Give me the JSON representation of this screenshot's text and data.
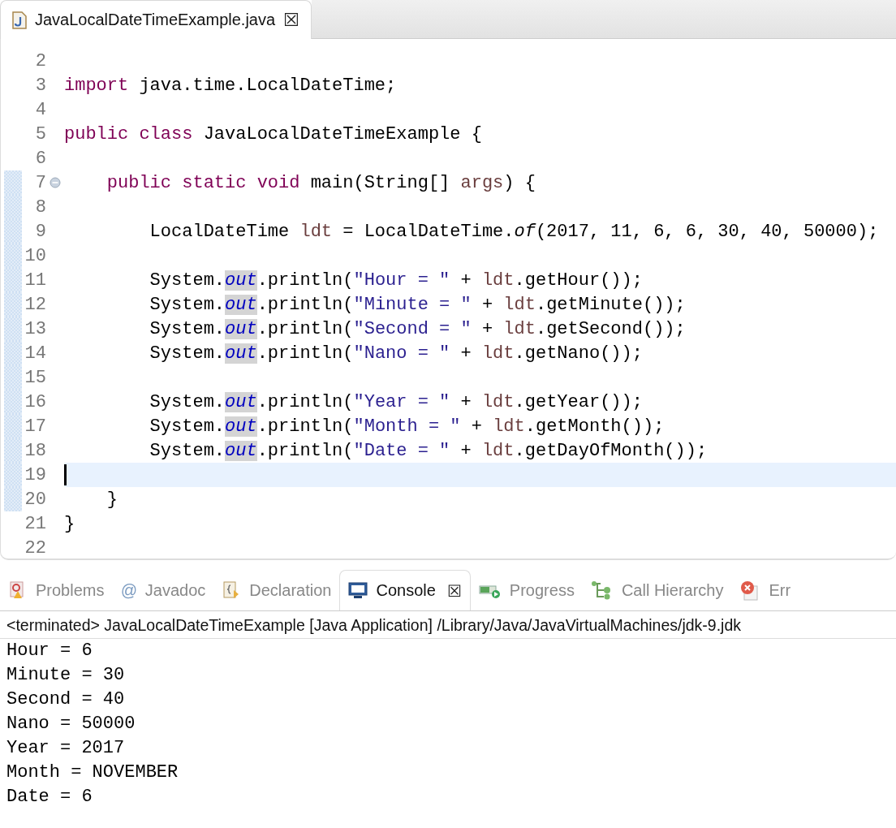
{
  "editor_tab": {
    "title": "JavaLocalDateTimeExample.java",
    "close": "☒"
  },
  "code_lines": [
    {
      "number": "2",
      "current": false,
      "changed": false,
      "fold": false
    },
    {
      "number": "3",
      "current": false,
      "changed": false,
      "fold": false,
      "tokens": [
        {
          "kind": "keyword",
          "text": "import"
        },
        {
          "kind": "plain",
          "text": " java.time.LocalDateTime;"
        }
      ]
    },
    {
      "number": "4",
      "current": false,
      "changed": false,
      "fold": false
    },
    {
      "number": "5",
      "current": false,
      "changed": false,
      "fold": false,
      "tokens": [
        {
          "kind": "keyword",
          "text": "public class"
        },
        {
          "kind": "plain",
          "text": " JavaLocalDateTimeExample {"
        }
      ]
    },
    {
      "number": "6",
      "current": false,
      "changed": false,
      "fold": false
    },
    {
      "number": "7",
      "current": false,
      "changed": true,
      "fold": true,
      "tokens": [
        {
          "kind": "keyword",
          "text": "    public static void"
        },
        {
          "kind": "plain",
          "text": " main(String[] "
        },
        {
          "kind": "local",
          "text": "args"
        },
        {
          "kind": "plain",
          "text": ") {"
        }
      ]
    },
    {
      "number": "8",
      "current": false,
      "changed": true,
      "fold": false
    },
    {
      "number": "9",
      "current": false,
      "changed": true,
      "fold": false,
      "tokens": [
        {
          "kind": "plain",
          "text": "        LocalDateTime "
        },
        {
          "kind": "local",
          "text": "ldt"
        },
        {
          "kind": "plain",
          "text": " = LocalDateTime."
        },
        {
          "kind": "static",
          "text": "of"
        },
        {
          "kind": "plain",
          "text": "(2017, 11, 6, 6, 30, 40, 50000);"
        }
      ]
    },
    {
      "number": "10",
      "current": false,
      "changed": true,
      "fold": false
    },
    {
      "number": "11",
      "current": false,
      "changed": true,
      "fold": false,
      "tokens": [
        {
          "kind": "plain",
          "text": "        System."
        },
        {
          "kind": "field",
          "text": "out"
        },
        {
          "kind": "plain",
          "text": ".println("
        },
        {
          "kind": "string",
          "text": "\"Hour = \""
        },
        {
          "kind": "plain",
          "text": " + "
        },
        {
          "kind": "local",
          "text": "ldt"
        },
        {
          "kind": "plain",
          "text": ".getHour());"
        }
      ]
    },
    {
      "number": "12",
      "current": false,
      "changed": true,
      "fold": false,
      "tokens": [
        {
          "kind": "plain",
          "text": "        System."
        },
        {
          "kind": "field",
          "text": "out"
        },
        {
          "kind": "plain",
          "text": ".println("
        },
        {
          "kind": "string",
          "text": "\"Minute = \""
        },
        {
          "kind": "plain",
          "text": " + "
        },
        {
          "kind": "local",
          "text": "ldt"
        },
        {
          "kind": "plain",
          "text": ".getMinute());"
        }
      ]
    },
    {
      "number": "13",
      "current": false,
      "changed": true,
      "fold": false,
      "tokens": [
        {
          "kind": "plain",
          "text": "        System."
        },
        {
          "kind": "field",
          "text": "out"
        },
        {
          "kind": "plain",
          "text": ".println("
        },
        {
          "kind": "string",
          "text": "\"Second = \""
        },
        {
          "kind": "plain",
          "text": " + "
        },
        {
          "kind": "local",
          "text": "ldt"
        },
        {
          "kind": "plain",
          "text": ".getSecond());"
        }
      ]
    },
    {
      "number": "14",
      "current": false,
      "changed": true,
      "fold": false,
      "tokens": [
        {
          "kind": "plain",
          "text": "        System."
        },
        {
          "kind": "field",
          "text": "out"
        },
        {
          "kind": "plain",
          "text": ".println("
        },
        {
          "kind": "string",
          "text": "\"Nano = \""
        },
        {
          "kind": "plain",
          "text": " + "
        },
        {
          "kind": "local",
          "text": "ldt"
        },
        {
          "kind": "plain",
          "text": ".getNano());"
        }
      ]
    },
    {
      "number": "15",
      "current": false,
      "changed": true,
      "fold": false
    },
    {
      "number": "16",
      "current": false,
      "changed": true,
      "fold": false,
      "tokens": [
        {
          "kind": "plain",
          "text": "        System."
        },
        {
          "kind": "field",
          "text": "out"
        },
        {
          "kind": "plain",
          "text": ".println("
        },
        {
          "kind": "string",
          "text": "\"Year = \""
        },
        {
          "kind": "plain",
          "text": " + "
        },
        {
          "kind": "local",
          "text": "ldt"
        },
        {
          "kind": "plain",
          "text": ".getYear());"
        }
      ]
    },
    {
      "number": "17",
      "current": false,
      "changed": true,
      "fold": false,
      "tokens": [
        {
          "kind": "plain",
          "text": "        System."
        },
        {
          "kind": "field",
          "text": "out"
        },
        {
          "kind": "plain",
          "text": ".println("
        },
        {
          "kind": "string",
          "text": "\"Month = \""
        },
        {
          "kind": "plain",
          "text": " + "
        },
        {
          "kind": "local",
          "text": "ldt"
        },
        {
          "kind": "plain",
          "text": ".getMonth());"
        }
      ]
    },
    {
      "number": "18",
      "current": false,
      "changed": true,
      "fold": false,
      "tokens": [
        {
          "kind": "plain",
          "text": "        System."
        },
        {
          "kind": "field",
          "text": "out"
        },
        {
          "kind": "plain",
          "text": ".println("
        },
        {
          "kind": "string",
          "text": "\"Date = \""
        },
        {
          "kind": "plain",
          "text": " + "
        },
        {
          "kind": "local",
          "text": "ldt"
        },
        {
          "kind": "plain",
          "text": ".getDayOfMonth());"
        }
      ]
    },
    {
      "number": "19",
      "current": true,
      "changed": true,
      "fold": false
    },
    {
      "number": "20",
      "current": false,
      "changed": true,
      "fold": false,
      "tokens": [
        {
          "kind": "plain",
          "text": "    }"
        }
      ]
    },
    {
      "number": "21",
      "current": false,
      "changed": false,
      "fold": false,
      "tokens": [
        {
          "kind": "plain",
          "text": "}"
        }
      ]
    },
    {
      "number": "22",
      "current": false,
      "changed": false,
      "fold": false
    }
  ],
  "view_tabs": [
    {
      "kind": "problems",
      "label": "Problems",
      "selected": false
    },
    {
      "kind": "javadoc",
      "label": "Javadoc",
      "selected": false,
      "glyph": "@"
    },
    {
      "kind": "declaration",
      "label": "Declaration",
      "selected": false
    },
    {
      "kind": "console",
      "label": "Console",
      "selected": true,
      "close": "☒"
    },
    {
      "kind": "progress",
      "label": "Progress",
      "selected": false
    },
    {
      "kind": "hierarchy",
      "label": "Call Hierarchy",
      "selected": false
    },
    {
      "kind": "error",
      "label": "Err",
      "selected": false
    }
  ],
  "console": {
    "header": "<terminated> JavaLocalDateTimeExample [Java Application] /Library/Java/JavaVirtualMachines/jdk-9.jdk",
    "output": [
      "Hour = 6",
      "Minute = 30",
      "Second = 40",
      "Nano = 50000",
      "Year = 2017",
      "Month = NOVEMBER",
      "Date = 6"
    ]
  }
}
